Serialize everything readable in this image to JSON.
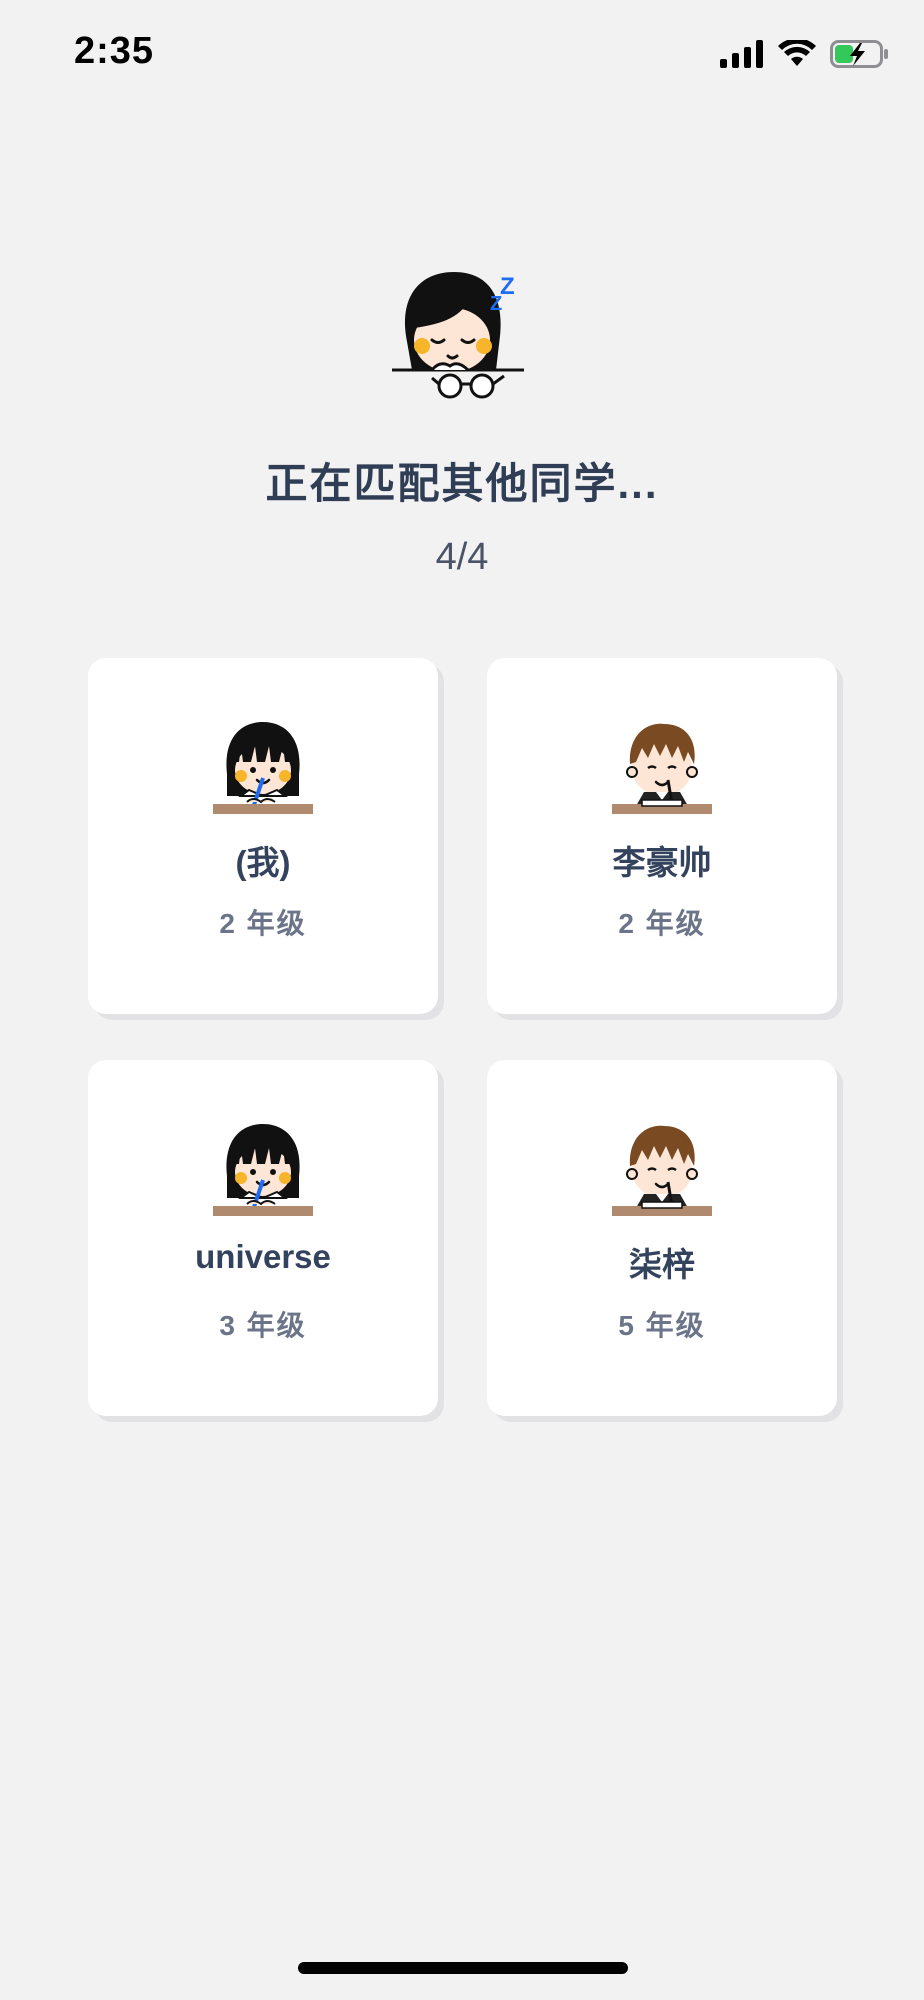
{
  "status_bar": {
    "time": "2:35"
  },
  "hero": {
    "icon": "sleeping-girl-icon",
    "zz": "Z Z",
    "title": "正在匹配其他同学...",
    "count": "4/4"
  },
  "students": [
    {
      "name": "(我)",
      "grade": "2 年级",
      "avatar": "girl-student-icon"
    },
    {
      "name": "李豪帅",
      "grade": "2 年级",
      "avatar": "boy-student-icon"
    },
    {
      "name": "universe",
      "grade": "3 年级",
      "avatar": "girl-student-icon"
    },
    {
      "name": "柒梓",
      "grade": "5 年级",
      "avatar": "boy-student-icon"
    }
  ],
  "colors": {
    "background": "#f2f2f3",
    "card": "#ffffff",
    "title": "#2f3d55",
    "grade": "#6b7488",
    "zz_accent": "#1e6cf2",
    "battery_green": "#34c759"
  }
}
